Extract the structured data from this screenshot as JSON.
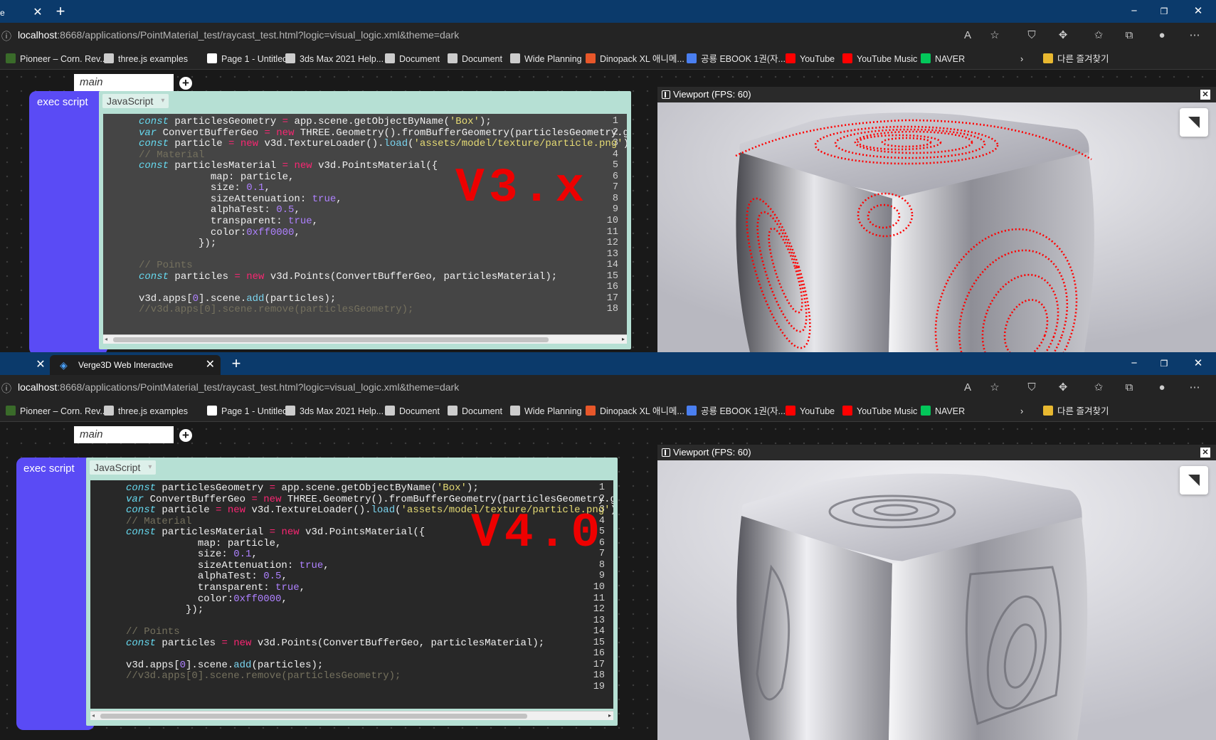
{
  "browser": {
    "url_host": "localhost",
    "url_rest": ":8668/applications/PointMaterial_test/raycast_test.html?logic=visual_logic.xml&theme=dark",
    "tab_title": "Verge3D Web Interactive",
    "bookmarks": [
      {
        "label": "Pioneer – Corn. Rev...",
        "icon": "leaf-icon",
        "color": "#3a6b2a"
      },
      {
        "label": "three.js examples",
        "icon": "threejs-icon",
        "color": "#cccccc"
      },
      {
        "label": "Page 1 - Untitled",
        "icon": "play-icon",
        "color": "#ffffff"
      },
      {
        "label": "3ds Max 2021 Help...",
        "icon": "autodesk-icon",
        "color": "#cccccc"
      },
      {
        "label": "Document",
        "icon": "document-icon",
        "color": "#cccccc"
      },
      {
        "label": "Document",
        "icon": "document-icon",
        "color": "#cccccc"
      },
      {
        "label": "Wide Planning",
        "icon": "document-icon",
        "color": "#cccccc"
      },
      {
        "label": "Dinopack XL 애니메...",
        "icon": "dinopack-icon",
        "color": "#e8572a"
      },
      {
        "label": "공룡 EBOOK 1권(자...",
        "icon": "docs-icon",
        "color": "#4a7ff0"
      },
      {
        "label": "YouTube",
        "icon": "youtube-icon",
        "color": "#ff0000"
      },
      {
        "label": "YouTube Music",
        "icon": "youtube-music-icon",
        "color": "#ff0000"
      },
      {
        "label": "NAVER",
        "icon": "naver-icon",
        "color": "#03c75a"
      }
    ],
    "other_favorites": "다른 즐겨찾기"
  },
  "workspace": {
    "tab_label": "main",
    "block_label": "exec script",
    "lang_label": "JavaScript"
  },
  "code_lines": [
    "const particlesGeometry = app.scene.getObjectByName('Box');",
    "var ConvertBufferGeo = new THREE.Geometry().fromBufferGeometry(particlesGeometry.geom",
    "const particle = new v3d.TextureLoader().load('assets/model/texture/particle.png');",
    "// Material",
    "const particlesMaterial = new v3d.PointsMaterial({",
    "            map: particle,",
    "            size: 0.1,",
    "            sizeAttenuation: true,",
    "            alphaTest: 0.5,",
    "            transparent: true,",
    "            color:0xff0000,",
    "          });",
    "",
    "// Points",
    "const particles = new v3d.Points(ConvertBufferGeo, particlesMaterial);",
    "",
    "v3d.apps[0].scene.add(particles);",
    "//v3d.apps[0].scene.remove(particlesGeometry);",
    ""
  ],
  "versions": {
    "top": "V3.x",
    "bottom": "V4.0"
  },
  "viewport": {
    "title": "Viewport (FPS: 60)"
  },
  "colors": {
    "titlebar": "#0b3a6b",
    "block": "#5a4bf5",
    "script_box": "#b6e0d4",
    "particles": "#ff0000"
  }
}
